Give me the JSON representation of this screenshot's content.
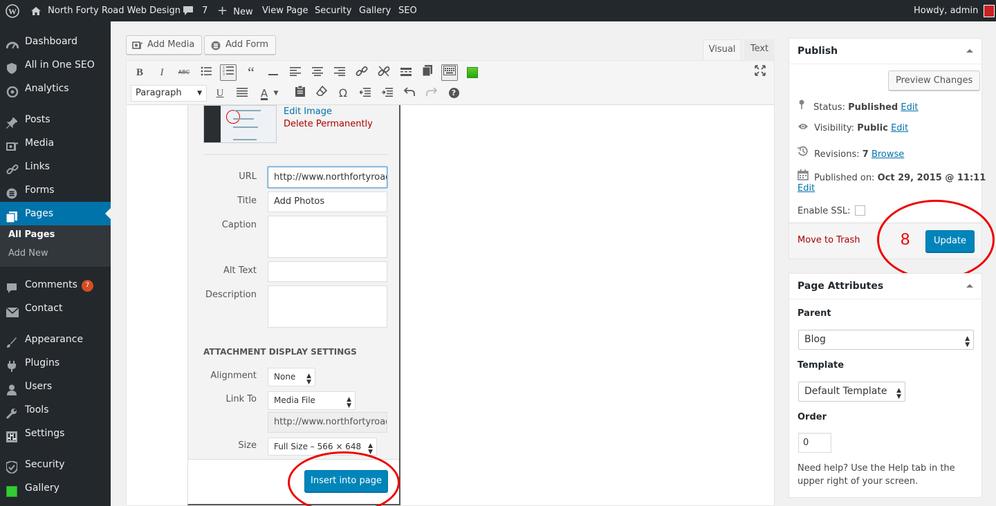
{
  "adminbar": {
    "site_name": "North Forty Road Web Design",
    "comments_count": "7",
    "new_label": "New",
    "view_page_label": "View Page",
    "security_label": "Security",
    "gallery_label": "Gallery",
    "seo_label": "SEO",
    "howdy": "Howdy, admin"
  },
  "sidebar": {
    "items": [
      {
        "label": "Dashboard",
        "icon": "dashboard-icon"
      },
      {
        "label": "All in One SEO",
        "icon": "shield-icon"
      },
      {
        "label": "Analytics",
        "icon": "analytics-icon"
      },
      {
        "label": "Posts",
        "icon": "pin-icon"
      },
      {
        "label": "Media",
        "icon": "media-icon"
      },
      {
        "label": "Links",
        "icon": "link-icon"
      },
      {
        "label": "Forms",
        "icon": "forms-icon"
      },
      {
        "label": "Pages",
        "icon": "pages-icon"
      },
      {
        "label": "Comments",
        "icon": "comment-icon",
        "badge": "7"
      },
      {
        "label": "Contact",
        "icon": "mail-icon"
      },
      {
        "label": "Appearance",
        "icon": "brush-icon"
      },
      {
        "label": "Plugins",
        "icon": "plug-icon"
      },
      {
        "label": "Users",
        "icon": "users-icon"
      },
      {
        "label": "Tools",
        "icon": "wrench-icon"
      },
      {
        "label": "Settings",
        "icon": "settings-icon"
      },
      {
        "label": "Security",
        "icon": "security-shield-icon"
      },
      {
        "label": "Gallery",
        "icon": "gallery-icon"
      }
    ],
    "submenu": [
      "All Pages",
      "Add New"
    ]
  },
  "editor": {
    "add_media": "Add Media",
    "add_form": "Add Form",
    "tab_visual": "Visual",
    "tab_text": "Text",
    "format_select": "Paragraph"
  },
  "attachment": {
    "edit_image": "Edit Image",
    "delete_permanently": "Delete Permanently",
    "url_label": "URL",
    "url_value": "http://www.northfortyroad.c",
    "title_label": "Title",
    "title_value": "Add Photos",
    "caption_label": "Caption",
    "alt_label": "Alt Text",
    "description_label": "Description",
    "display_heading": "ATTACHMENT DISPLAY SETTINGS",
    "alignment_label": "Alignment",
    "alignment_value": "None",
    "link_to_label": "Link To",
    "link_to_value": "Media File",
    "link_url_value": "http://www.northfortyroad.c",
    "size_label": "Size",
    "size_value": "Full Size – 566 × 648",
    "insert_button": "Insert into page"
  },
  "publish": {
    "title": "Publish",
    "preview_button": "Preview Changes",
    "status_label": "Status:",
    "status_value": "Published",
    "visibility_label": "Visibility:",
    "visibility_value": "Public",
    "revisions_label": "Revisions:",
    "revisions_value": "7",
    "browse_link": "Browse",
    "published_on_label": "Published on:",
    "published_on_value": "Oct 29, 2015 @ 11:11",
    "edit_link": "Edit",
    "enable_ssl": "Enable SSL:",
    "move_to_trash": "Move to Trash",
    "step_number": "8",
    "update_button": "Update"
  },
  "page_attributes": {
    "title": "Page Attributes",
    "parent_label": "Parent",
    "parent_value": "Blog",
    "template_label": "Template",
    "template_value": "Default Template",
    "order_label": "Order",
    "order_value": "0",
    "help_text": "Need help? Use the Help tab in the upper right of your screen."
  },
  "colors": {
    "accent": "#0073aa",
    "primary_button": "#0085ba",
    "admin_bar": "#23282d",
    "annotation_red": "#e00000",
    "trash_red": "#a00000"
  }
}
